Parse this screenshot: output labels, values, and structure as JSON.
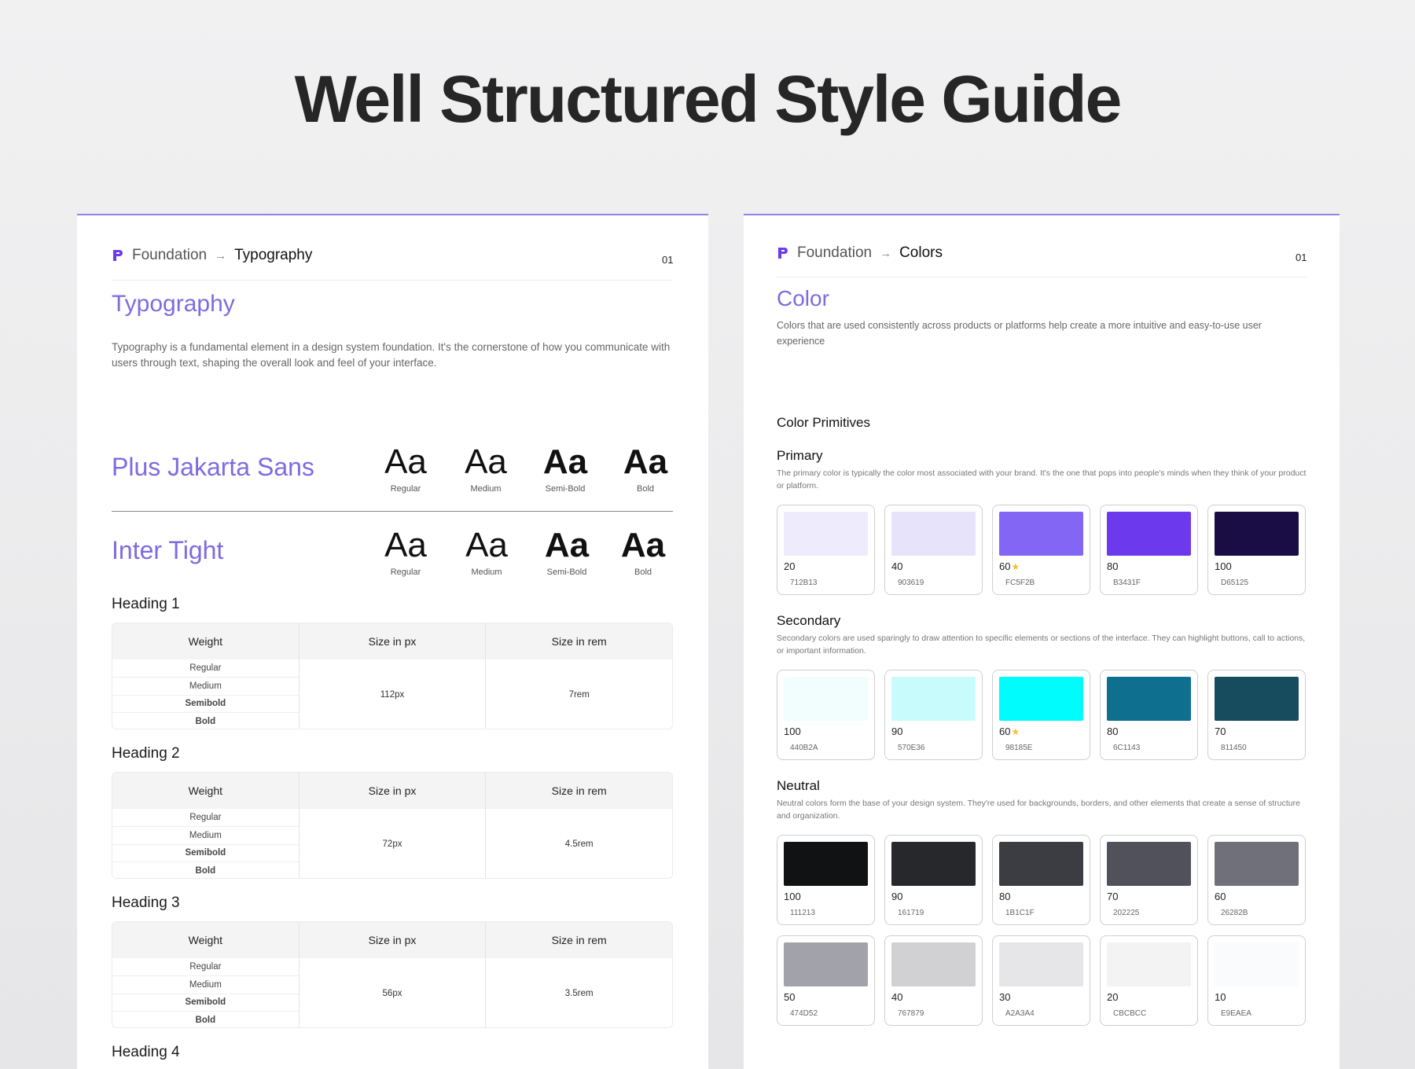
{
  "page": {
    "title": "Well Structured Style Guide"
  },
  "typography": {
    "crumb_parent": "Foundation",
    "crumb_current": "Typography",
    "page_num": "01",
    "title": "Typography",
    "description": "Typography is a fundamental element in a design system foundation. It's the cornerstone of how you communicate with users through text, shaping the overall look and feel of your interface.",
    "fonts": [
      {
        "name": "Plus Jakarta Sans",
        "samples": [
          {
            "glyph": "Aa",
            "weight": "Regular"
          },
          {
            "glyph": "Aa",
            "weight": "Medium"
          },
          {
            "glyph": "Aa",
            "weight": "Semi-Bold"
          },
          {
            "glyph": "Aa",
            "weight": "Bold"
          }
        ]
      },
      {
        "name": "Inter Tight",
        "samples": [
          {
            "glyph": "Aa",
            "weight": "Regular"
          },
          {
            "glyph": "Aa",
            "weight": "Medium"
          },
          {
            "glyph": "Aa",
            "weight": "Semi-Bold"
          },
          {
            "glyph": "Aa",
            "weight": "Bold"
          }
        ]
      }
    ],
    "table_headers": {
      "weight": "Weight",
      "px": "Size in px",
      "rem": "Size in rem"
    },
    "weights": [
      "Regular",
      "Medium",
      "Semibold",
      "Bold"
    ],
    "headings": [
      {
        "label": "Heading 1",
        "px": "112px",
        "rem": "7rem"
      },
      {
        "label": "Heading 2",
        "px": "72px",
        "rem": "4.5rem"
      },
      {
        "label": "Heading 3",
        "px": "56px",
        "rem": "3.5rem"
      },
      {
        "label": "Heading 4"
      }
    ]
  },
  "colors": {
    "crumb_parent": "Foundation",
    "crumb_current": "Colors",
    "page_num": "01",
    "title": "Color",
    "description": "Colors that are used consistently across products or platforms help create a more intuitive and easy-to-use user experience",
    "primitives_label": "Color Primitives",
    "primary": {
      "title": "Primary",
      "description": "The primary color is typically the color most associated with your brand. It's the one that pops into people's minds when they think of your product or platform.",
      "swatches": [
        {
          "level": "20",
          "hex": "712B13",
          "color": "#eeebfd",
          "star": false
        },
        {
          "level": "40",
          "hex": "903619",
          "color": "#e6e3fb",
          "star": false
        },
        {
          "level": "60",
          "hex": "FC5F2B",
          "color": "#8466f5",
          "star": true
        },
        {
          "level": "80",
          "hex": "B3431F",
          "color": "#6c3aec",
          "star": false
        },
        {
          "level": "100",
          "hex": "D65125",
          "color": "#1a0d45",
          "star": false
        }
      ]
    },
    "secondary": {
      "title": "Secondary",
      "description": "Secondary colors are used sparingly to draw attention to specific elements or sections of the interface. They can highlight buttons, call to actions, or important information.",
      "swatches": [
        {
          "level": "100",
          "hex": "440B2A",
          "color": "#f2fefe",
          "star": false
        },
        {
          "level": "90",
          "hex": "570E36",
          "color": "#c8fcfc",
          "star": false
        },
        {
          "level": "60",
          "hex": "98185E",
          "color": "#00fcfc",
          "star": true
        },
        {
          "level": "80",
          "hex": "6C1143",
          "color": "#0e6f8e",
          "star": false
        },
        {
          "level": "70",
          "hex": "811450",
          "color": "#174b5e",
          "star": false
        }
      ]
    },
    "neutral": {
      "title": "Neutral",
      "description": "Neutral colors form the base of your design system. They're used for backgrounds, borders, and other elements that create a sense of structure and organization.",
      "swatches": [
        {
          "level": "100",
          "hex": "111213",
          "color": "#111213",
          "star": false
        },
        {
          "level": "90",
          "hex": "161719",
          "color": "#27282b",
          "star": false
        },
        {
          "level": "80",
          "hex": "1B1C1F",
          "color": "#3c3d42",
          "star": false
        },
        {
          "level": "70",
          "hex": "202225",
          "color": "#50515a",
          "star": false
        },
        {
          "level": "60",
          "hex": "26282B",
          "color": "#6f7079",
          "star": false
        },
        {
          "level": "50",
          "hex": "474D52",
          "color": "#a2a3aa",
          "star": false
        },
        {
          "level": "40",
          "hex": "767879",
          "color": "#d1d1d4",
          "star": false
        },
        {
          "level": "30",
          "hex": "A2A3A4",
          "color": "#e6e6e8",
          "star": false
        },
        {
          "level": "20",
          "hex": "CBCBCC",
          "color": "#f3f3f4",
          "star": false
        },
        {
          "level": "10",
          "hex": "E9EAEA",
          "color": "#fafbfc",
          "star": false
        }
      ]
    }
  }
}
